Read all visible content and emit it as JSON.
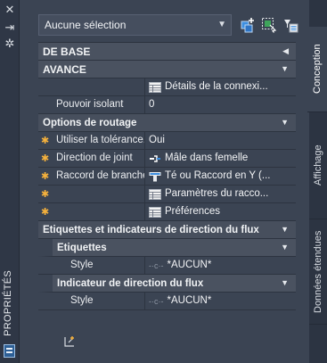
{
  "palette": {
    "title": "PROPRIÉTÉS"
  },
  "selection": {
    "value": "Aucune sélection"
  },
  "toolbar": {
    "icons": [
      "toggle-pickadd-icon",
      "select-objects-icon",
      "quick-select-icon"
    ]
  },
  "categories": {
    "base": "DE BASE",
    "avance": "AVANCE",
    "routage": "Options de routage",
    "etiquettes_flux": "Etiquettes et indicateurs de direction du flux",
    "etiquettes": "Etiquettes",
    "indicateur": "Indicateur de direction du flux"
  },
  "avance": {
    "details_value": "Détails de la connexi...",
    "pouvoir_label": "Pouvoir isolant",
    "pouvoir_value": "0"
  },
  "routage": {
    "tolerance_label": "Utiliser la tolérance...",
    "tolerance_value": "Oui",
    "joint_label": "Direction de joint",
    "joint_value": "Mâle dans femelle",
    "branche_label": "Raccord de branche",
    "branche_value": "Té ou Raccord en Y (...",
    "parametres_value": "Paramètres du racco...",
    "preferences_value": "Préférences"
  },
  "etiquettes": {
    "style_label": "Style",
    "style_value": "*AUCUN*"
  },
  "indicateur": {
    "style_label": "Style",
    "style_value": "*AUCUN*"
  },
  "tabs": [
    "Conception",
    "Affichage",
    "Données étendues"
  ],
  "colors": {
    "panel": "#3b4453",
    "category": "#474f5d",
    "required_star": "#f6b23c",
    "accent_blue": "#3d8fe0"
  }
}
